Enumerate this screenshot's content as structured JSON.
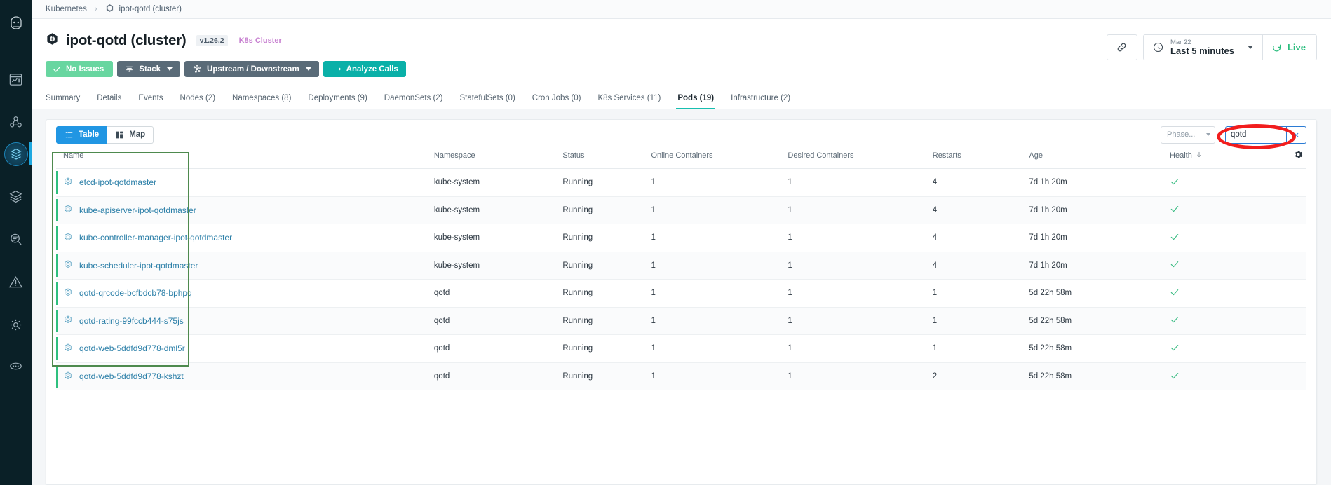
{
  "rail": {
    "items": [
      {
        "name": "home-logo-icon",
        "label": "Home"
      },
      {
        "name": "dashboard-icon",
        "label": "Dashboards"
      },
      {
        "name": "topology-icon",
        "label": "Topology"
      },
      {
        "name": "kubernetes-icon",
        "label": "Kubernetes"
      },
      {
        "name": "stack-layers-icon",
        "label": "Stacks"
      },
      {
        "name": "explore-search-icon",
        "label": "Explore"
      },
      {
        "name": "alerts-warning-icon",
        "label": "Alerts"
      },
      {
        "name": "settings-gear-icon",
        "label": "Settings"
      },
      {
        "name": "more-dots-icon",
        "label": "More"
      }
    ],
    "active_index": 3
  },
  "breadcrumb": {
    "root": "Kubernetes",
    "separator": "›",
    "current": "ipot-qotd (cluster)"
  },
  "header": {
    "title": "ipot-qotd (cluster)",
    "version_badge": "v1.26.2",
    "kind_badge": "K8s Cluster"
  },
  "actions": {
    "no_issues": "No Issues",
    "stack": "Stack",
    "upstream_downstream": "Upstream / Downstream",
    "analyze_calls": "Analyze Calls"
  },
  "toolbar": {
    "link_icon": "link-icon",
    "time_date": "Mar 22",
    "time_range": "Last 5 minutes",
    "live_label": "Live"
  },
  "tabs": [
    {
      "label": "Summary",
      "active": false
    },
    {
      "label": "Details",
      "active": false
    },
    {
      "label": "Events",
      "active": false
    },
    {
      "label": "Nodes (2)",
      "active": false
    },
    {
      "label": "Namespaces (8)",
      "active": false
    },
    {
      "label": "Deployments (9)",
      "active": false
    },
    {
      "label": "DaemonSets (2)",
      "active": false
    },
    {
      "label": "StatefulSets (0)",
      "active": false
    },
    {
      "label": "Cron Jobs (0)",
      "active": false
    },
    {
      "label": "K8s Services (11)",
      "active": false
    },
    {
      "label": "Pods (19)",
      "active": true
    },
    {
      "label": "Infrastructure (2)",
      "active": false
    }
  ],
  "view_toggle": {
    "table": "Table",
    "map": "Map",
    "selected": "Table"
  },
  "filters": {
    "phase_placeholder": "Phase...",
    "search_value": "qotd",
    "clear_label": "×"
  },
  "table": {
    "columns": [
      "Name",
      "Namespace",
      "Status",
      "Online Containers",
      "Desired Containers",
      "Restarts",
      "Age",
      "Health"
    ],
    "sorted_column": "Health",
    "sort_direction": "desc",
    "settings_icon": "gear-icon",
    "rows": [
      {
        "name": "etcd-ipot-qotdmaster",
        "namespace": "kube-system",
        "status": "Running",
        "online_containers": "1",
        "desired_containers": "1",
        "restarts": "4",
        "age": "7d 1h 20m",
        "health": "✓"
      },
      {
        "name": "kube-apiserver-ipot-qotdmaster",
        "namespace": "kube-system",
        "status": "Running",
        "online_containers": "1",
        "desired_containers": "1",
        "restarts": "4",
        "age": "7d 1h 20m",
        "health": "✓"
      },
      {
        "name": "kube-controller-manager-ipot-qotdmaster",
        "namespace": "kube-system",
        "status": "Running",
        "online_containers": "1",
        "desired_containers": "1",
        "restarts": "4",
        "age": "7d 1h 20m",
        "health": "✓"
      },
      {
        "name": "kube-scheduler-ipot-qotdmaster",
        "namespace": "kube-system",
        "status": "Running",
        "online_containers": "1",
        "desired_containers": "1",
        "restarts": "4",
        "age": "7d 1h 20m",
        "health": "✓"
      },
      {
        "name": "qotd-qrcode-bcfbdcb78-bphpq",
        "namespace": "qotd",
        "status": "Running",
        "online_containers": "1",
        "desired_containers": "1",
        "restarts": "1",
        "age": "5d 22h 58m",
        "health": "✓"
      },
      {
        "name": "qotd-rating-99fccb444-s75js",
        "namespace": "qotd",
        "status": "Running",
        "online_containers": "1",
        "desired_containers": "1",
        "restarts": "1",
        "age": "5d 22h 58m",
        "health": "✓"
      },
      {
        "name": "qotd-web-5ddfd9d778-dml5r",
        "namespace": "qotd",
        "status": "Running",
        "online_containers": "1",
        "desired_containers": "1",
        "restarts": "1",
        "age": "5d 22h 58m",
        "health": "✓"
      },
      {
        "name": "qotd-web-5ddfd9d778-kshzt",
        "namespace": "qotd",
        "status": "Running",
        "online_containers": "1",
        "desired_containers": "1",
        "restarts": "2",
        "age": "5d 22h 58m",
        "health": "✓"
      }
    ]
  },
  "annotations": {
    "search_highlight_color": "#f21d1d",
    "name_column_highlight_color": "#4e8a4e"
  }
}
